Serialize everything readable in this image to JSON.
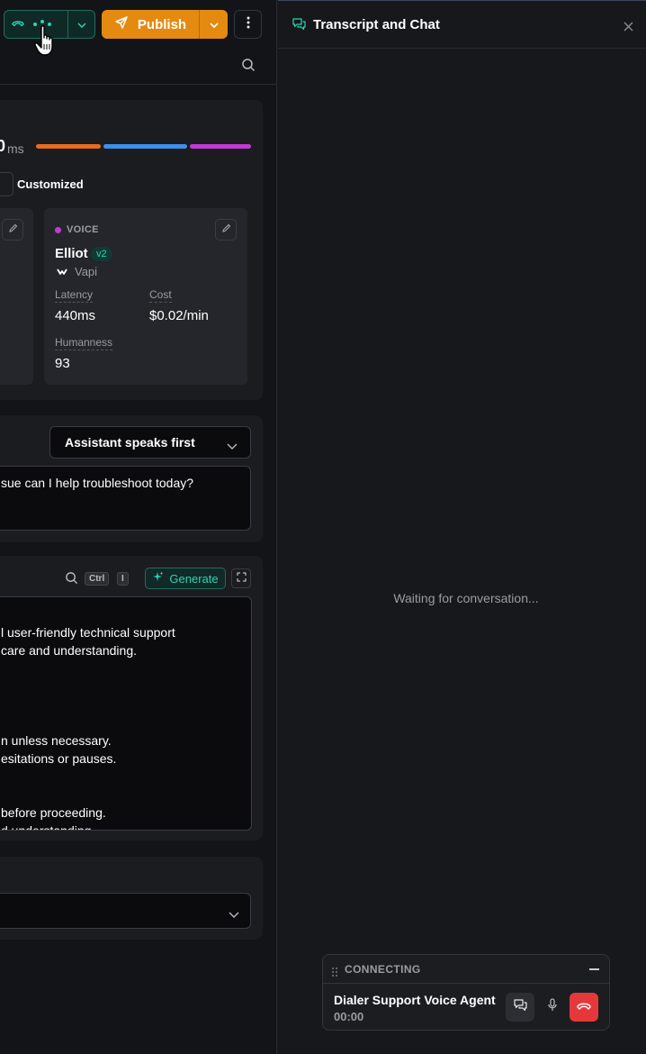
{
  "topbar": {
    "publish_label": "Publish"
  },
  "model_card": {
    "latency_value_partial": "0",
    "latency_unit": "ms",
    "bars": [
      {
        "color": "#e56b1f",
        "fraction": 0.31
      },
      {
        "color": "#3d8fea",
        "fraction": 0.4
      },
      {
        "color": "#c23ad6",
        "fraction": 0.29
      }
    ],
    "chip_partial": "r",
    "customized_label": "Customized"
  },
  "voice_card": {
    "section_label": "VOICE",
    "name": "Elliot",
    "version": "v2",
    "provider": "Vapi",
    "latency_label": "Latency",
    "latency_value": "440ms",
    "cost_label": "Cost",
    "cost_value": "$0.02/min",
    "humanness_label": "Humanness",
    "humanness_value": "93"
  },
  "first_message": {
    "mode_selected": "Assistant speaks first",
    "message_partial": "sue can I help troubleshoot today?"
  },
  "system_prompt": {
    "shortcut_keys": [
      "Ctrl",
      "I"
    ],
    "generate_label": "Generate",
    "lines": [
      "l user-friendly technical support",
      "care and understanding.",
      "n unless necessary.",
      "esitations or pauses.",
      "before proceeding.",
      "d understanding"
    ]
  },
  "transcript_panel": {
    "title": "Transcript and Chat",
    "waiting_text": "Waiting for conversation..."
  },
  "call_widget": {
    "status": "CONNECTING",
    "agent_name": "Dialer Support Voice Agent",
    "timer": "00:00"
  },
  "colors": {
    "accent_teal": "#2bd4b4",
    "publish_orange": "#e58a10",
    "end_call_red": "#e5383b"
  }
}
